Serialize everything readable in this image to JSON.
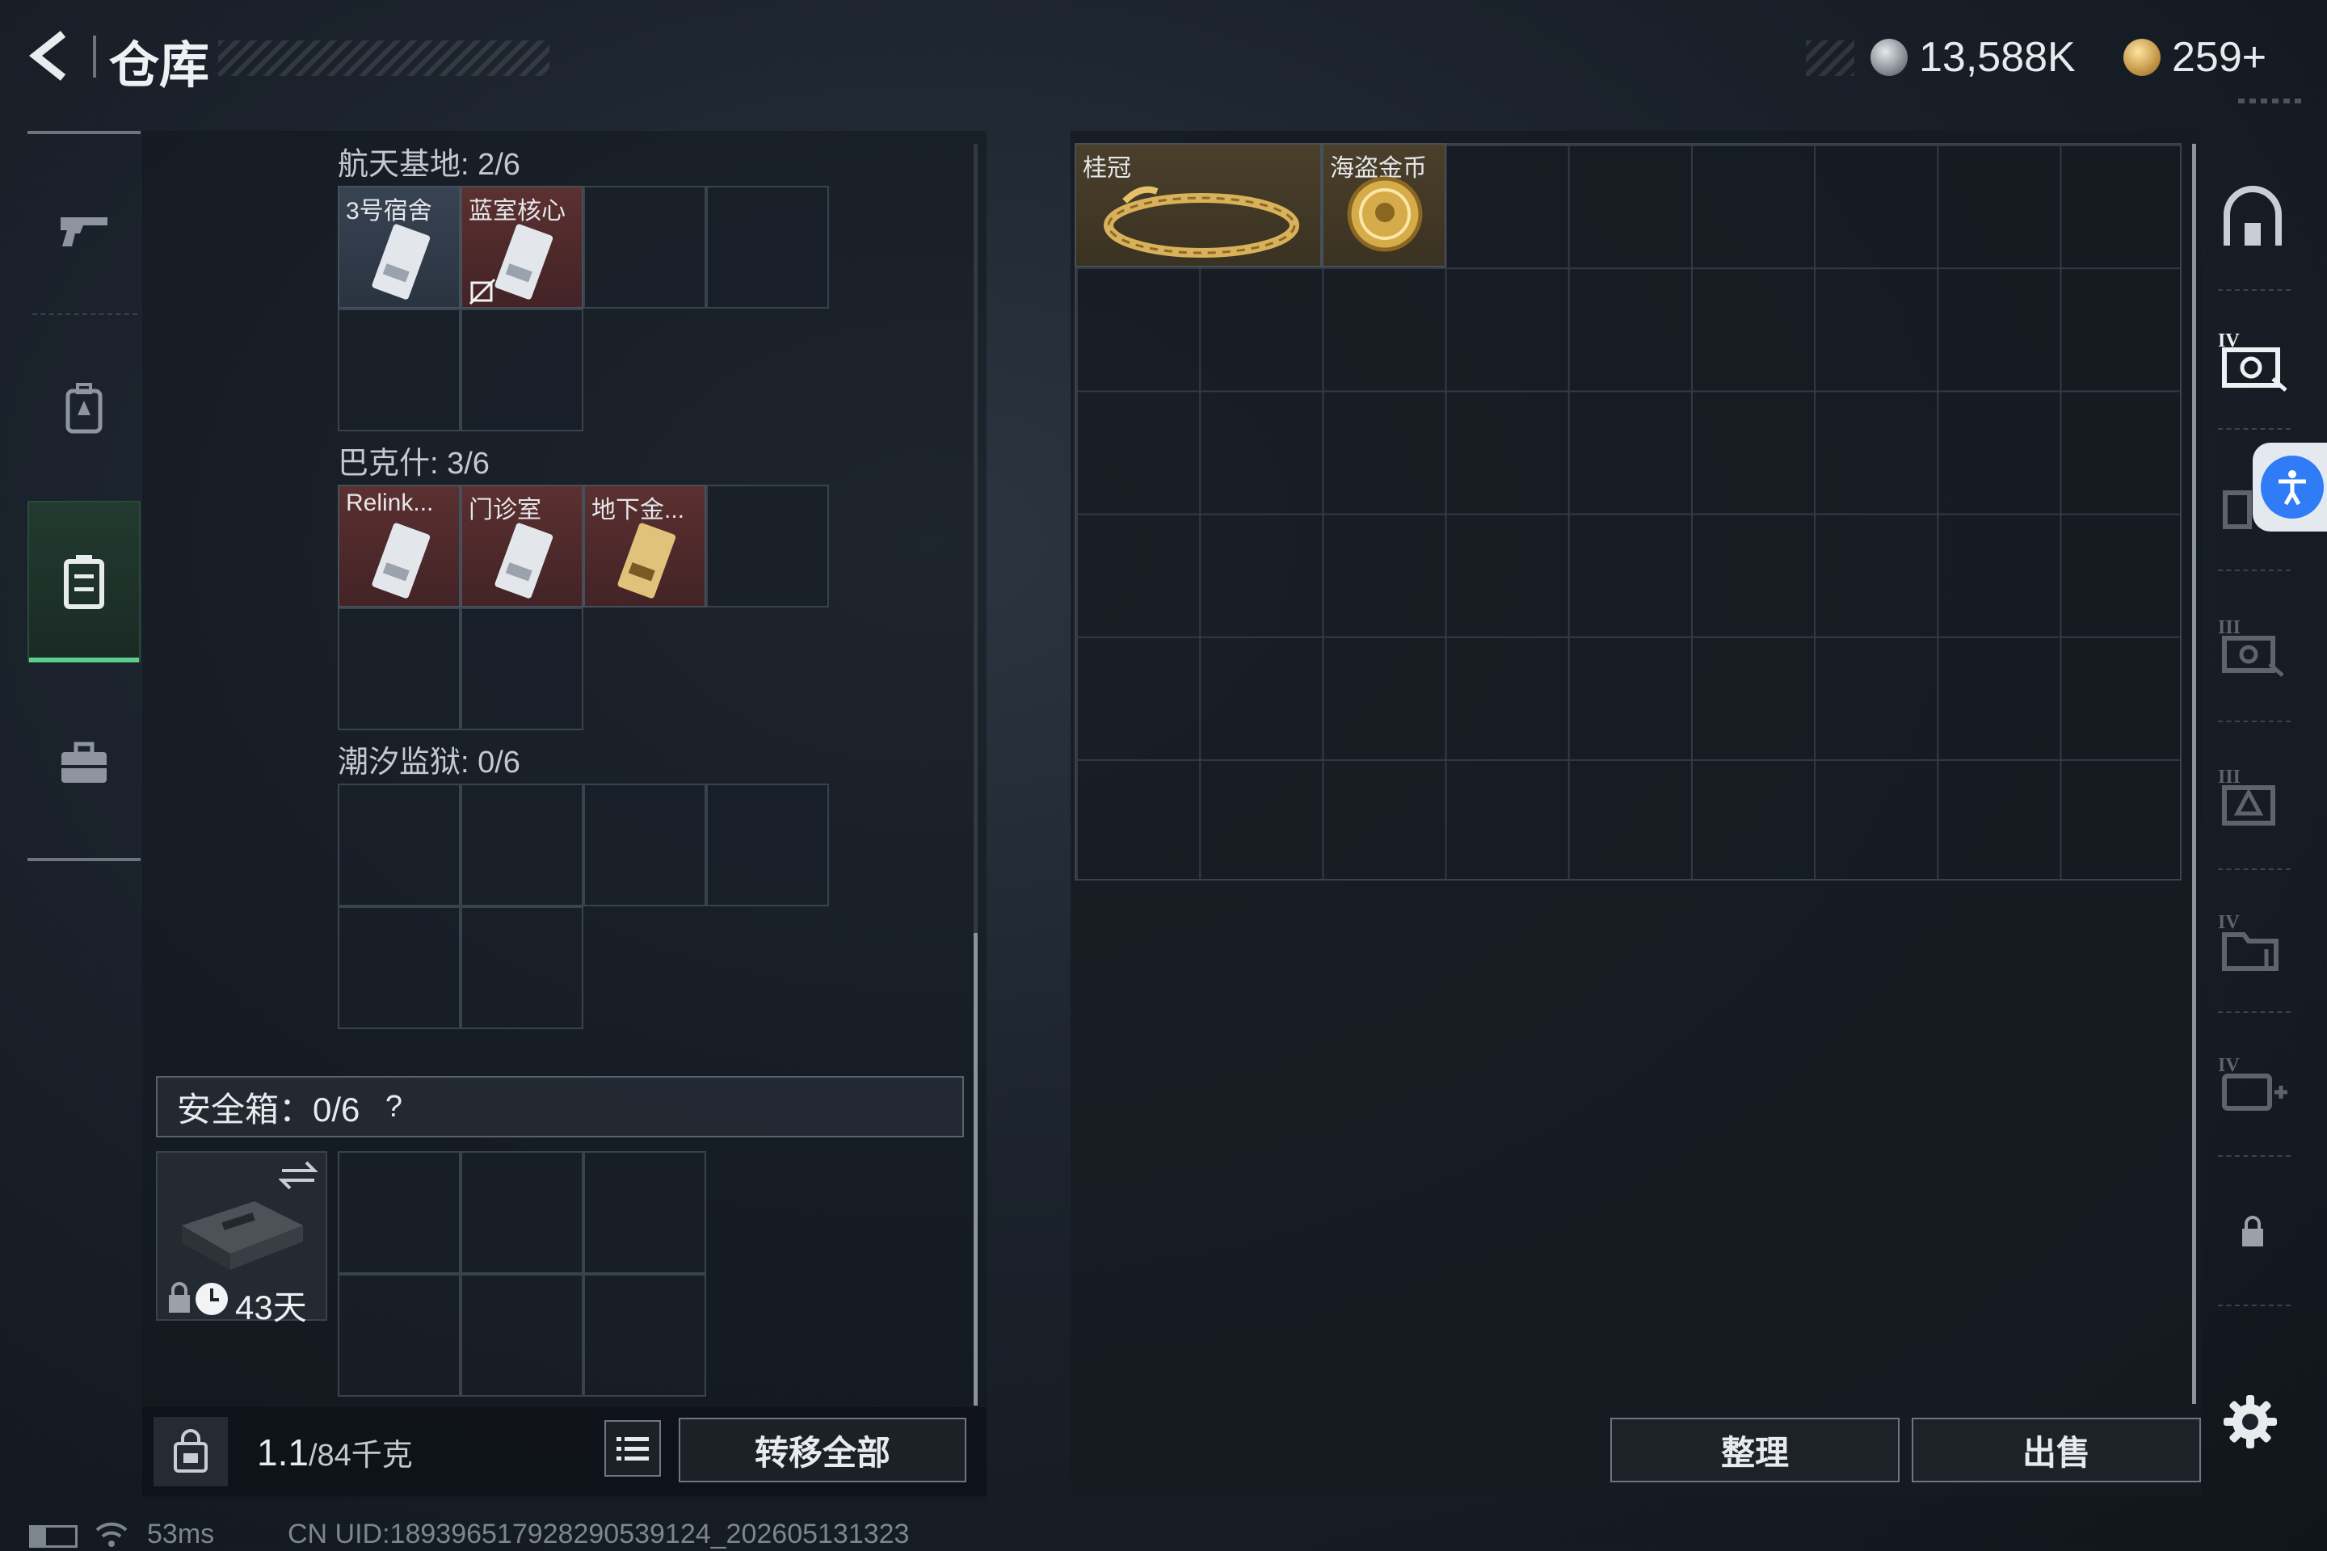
{
  "header": {
    "title": "仓库",
    "currency_primary": "13,588K",
    "currency_secondary": "259+"
  },
  "sections": [
    {
      "label": "航天基地: 2/6",
      "items": [
        {
          "name": "3号宿舍",
          "tint": "blue"
        },
        {
          "name": "蓝室核心",
          "tint": "red"
        }
      ]
    },
    {
      "label": "巴克什: 3/6",
      "items": [
        {
          "name": "Relink...",
          "tint": "red"
        },
        {
          "name": "门诊室",
          "tint": "red"
        },
        {
          "name": "地下金...",
          "tint": "red"
        }
      ]
    },
    {
      "label": "潮汐监狱: 0/6",
      "items": []
    }
  ],
  "safe_box": {
    "label": "安全箱：0/6",
    "help": "?",
    "duration": "43天"
  },
  "bottom_left": {
    "weight_current": "1.1",
    "weight_max": "/84千克",
    "transfer_all": "转移全部"
  },
  "storage": {
    "items": [
      {
        "name": "桂冠"
      },
      {
        "name": "海盗金币"
      }
    ],
    "organize": "整理",
    "sell": "出售"
  },
  "status_bar": {
    "ping": "53ms",
    "uid": "CN UID:189396517928290539124_202605131323"
  },
  "colors": {
    "accent_green": "#5ad08c",
    "accessibility_blue": "#2f7cf6",
    "item_red": "#5b3030",
    "item_blue": "#384353"
  },
  "icons": {
    "back": "back-arrow-icon",
    "nav": [
      "gun-icon",
      "backpack-icon",
      "locker-icon",
      "briefcase-icon"
    ],
    "right_sidebar": [
      "storage-arch-icon",
      "tier4-safe-icon",
      "tier3-rack-icon",
      "tier3-safe-icon",
      "tier3-crate-icon",
      "tier4-folder-icon",
      "tier4-medkit-icon",
      "lock-icon"
    ],
    "settings": "gear-icon"
  }
}
